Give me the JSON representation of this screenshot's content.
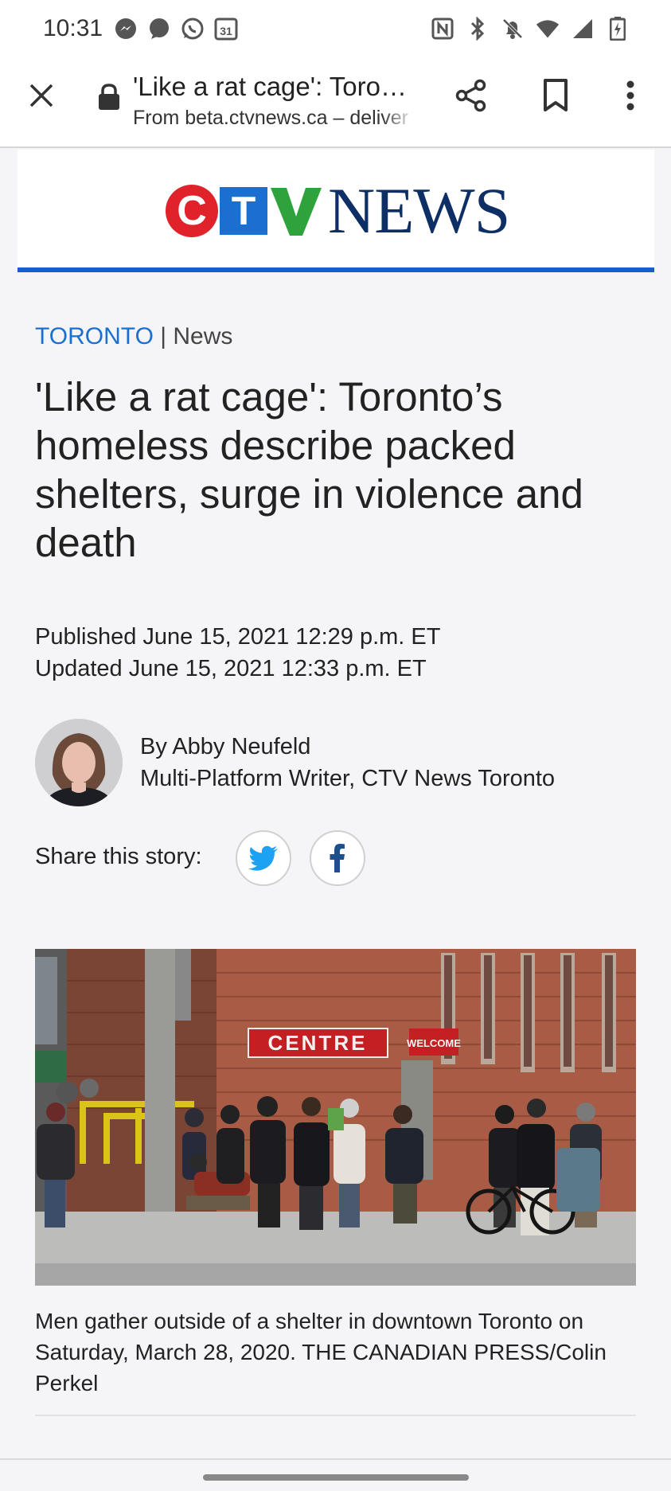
{
  "status_bar": {
    "time": "10:31",
    "calendar_day": "31",
    "left_icons": [
      "messenger-icon",
      "chat-bubble-icon",
      "whatsapp-icon",
      "calendar-icon"
    ],
    "right_icons": [
      "nfc-icon",
      "bluetooth-icon",
      "muted-bell-icon",
      "wifi-icon",
      "signal-icon",
      "battery-icon"
    ]
  },
  "app_bar": {
    "title": "'Like a rat cage': Toro…",
    "url": "From beta.ctvnews.ca – deliver"
  },
  "logo": {
    "c": "C",
    "t": "T",
    "news": "NEWS",
    "colors": {
      "red": "#e0232b",
      "blue": "#1a6fd1",
      "green": "#2fa33b",
      "navy": "#0e2f66"
    }
  },
  "article": {
    "category": "TORONTO",
    "separator": " | ",
    "section": "News",
    "headline": "'Like a rat cage': Toronto’s homeless describe packed shelters, surge in violence and death",
    "published": "Published June 15, 2021 12:29 p.m. ET",
    "updated": "Updated June 15, 2021 12:33 p.m. ET",
    "author": "By Abby Neufeld",
    "author_title": "Multi-Platform Writer, CTV News Toronto",
    "share_label": "Share this story:",
    "photo": {
      "sign_centre": "CENTRE",
      "sign_welcome": "WELCOME"
    },
    "caption": "Men gather outside of a shelter in downtown Toronto on Saturday, March 28, 2020. THE CANADIAN PRESS/Colin Perkel"
  },
  "accent_color": "#1a5bd1"
}
